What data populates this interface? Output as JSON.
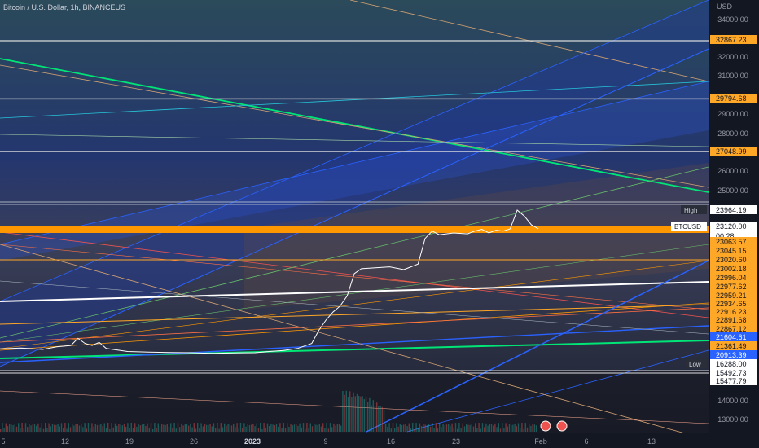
{
  "header": {
    "title": "Bitcoin / U.S. Dollar, 1h, BINANCEUS"
  },
  "chart_data": {
    "type": "line",
    "symbol": "BTCUSD",
    "currency_label": "USD",
    "price_ticks": [
      {
        "value": 34000,
        "label": "34000.00"
      },
      {
        "value": 32000,
        "label": "32000.00"
      },
      {
        "value": 31000,
        "label": "31000.00"
      },
      {
        "value": 29000,
        "label": "29000.00"
      },
      {
        "value": 28000,
        "label": "28000.00"
      },
      {
        "value": 26000,
        "label": "26000.00"
      },
      {
        "value": 25000,
        "label": "25000.00"
      },
      {
        "value": 14000,
        "label": "14000.00"
      },
      {
        "value": 13000,
        "label": "13000.00"
      }
    ],
    "x_ticks": [
      "5",
      "12",
      "19",
      "26",
      "2023",
      "9",
      "16",
      "23",
      "Feb",
      "6",
      "13"
    ],
    "price_labels": [
      {
        "text": "32867.23",
        "value": 32867.23,
        "bg": "#ffa726",
        "fg": "#131722"
      },
      {
        "text": "29794.68",
        "value": 29794.68,
        "bg": "#ffa726",
        "fg": "#131722"
      },
      {
        "text": "27048.99",
        "value": 27048.99,
        "bg": "#ffa726",
        "fg": "#131722"
      },
      {
        "text": "23964.19",
        "value": 23964.19,
        "bg": "#ffffff",
        "fg": "#131722",
        "tag": "High"
      },
      {
        "text": "23120.00",
        "value": 23120.0,
        "bg": "#ffffff",
        "fg": "#131722",
        "tag": "BTCUSD"
      },
      {
        "text": "00:28",
        "value": 23110,
        "bg": "#ffffff",
        "fg": "#131722"
      },
      {
        "text": "23063.57",
        "value": 23063.57,
        "bg": "#ffa726",
        "fg": "#131722"
      },
      {
        "text": "23045.15",
        "value": 23045.15,
        "bg": "#ffa726",
        "fg": "#131722"
      },
      {
        "text": "23020.60",
        "value": 23020.6,
        "bg": "#ffa726",
        "fg": "#131722"
      },
      {
        "text": "23002.18",
        "value": 23002.18,
        "bg": "#ffa726",
        "fg": "#131722"
      },
      {
        "text": "22996.04",
        "value": 22996.04,
        "bg": "#ffa726",
        "fg": "#131722"
      },
      {
        "text": "22977.62",
        "value": 22977.62,
        "bg": "#ffa726",
        "fg": "#131722"
      },
      {
        "text": "22959.21",
        "value": 22959.21,
        "bg": "#ffa726",
        "fg": "#131722"
      },
      {
        "text": "22934.65",
        "value": 22934.65,
        "bg": "#ffa726",
        "fg": "#131722"
      },
      {
        "text": "22916.23",
        "value": 22916.23,
        "bg": "#ffa726",
        "fg": "#131722"
      },
      {
        "text": "22891.68",
        "value": 22891.68,
        "bg": "#ffa726",
        "fg": "#131722"
      },
      {
        "text": "22867.12",
        "value": 22867.12,
        "bg": "#ffa726",
        "fg": "#131722"
      },
      {
        "text": "21604.61",
        "value": 21604.61,
        "bg": "#2962ff",
        "fg": "#ffffff"
      },
      {
        "text": "21361.49",
        "value": 21361.49,
        "bg": "#ffa726",
        "fg": "#131722"
      },
      {
        "text": "20913.39",
        "value": 20913.39,
        "bg": "#2962ff",
        "fg": "#ffffff"
      },
      {
        "text": "16288.00",
        "value": 16288.0,
        "bg": "#ffffff",
        "fg": "#131722",
        "tag": "Low"
      },
      {
        "text": "15492.73",
        "value": 15492.73,
        "bg": "#ffffff",
        "fg": "#131722"
      },
      {
        "text": "15477.79",
        "value": 15477.79,
        "bg": "#ffffff",
        "fg": "#131722"
      }
    ],
    "price_series": [
      [
        0,
        16980
      ],
      [
        0.03,
        17020
      ],
      [
        0.06,
        16950
      ],
      [
        0.08,
        17080
      ],
      [
        0.1,
        17150
      ],
      [
        0.11,
        17500
      ],
      [
        0.12,
        17250
      ],
      [
        0.13,
        17150
      ],
      [
        0.14,
        17300
      ],
      [
        0.15,
        17000
      ],
      [
        0.18,
        16850
      ],
      [
        0.21,
        16820
      ],
      [
        0.24,
        16800
      ],
      [
        0.27,
        16790
      ],
      [
        0.3,
        16760
      ],
      [
        0.33,
        16780
      ],
      [
        0.36,
        16790
      ],
      [
        0.38,
        16850
      ],
      [
        0.4,
        16900
      ],
      [
        0.42,
        17000
      ],
      [
        0.44,
        17250
      ],
      [
        0.45,
        17900
      ],
      [
        0.46,
        18400
      ],
      [
        0.47,
        18800
      ],
      [
        0.48,
        19100
      ],
      [
        0.49,
        19600
      ],
      [
        0.5,
        20700
      ],
      [
        0.51,
        20950
      ],
      [
        0.53,
        21000
      ],
      [
        0.55,
        21050
      ],
      [
        0.57,
        20900
      ],
      [
        0.58,
        21050
      ],
      [
        0.59,
        21200
      ],
      [
        0.6,
        22600
      ],
      [
        0.61,
        23000
      ],
      [
        0.62,
        22800
      ],
      [
        0.64,
        22900
      ],
      [
        0.66,
        22850
      ],
      [
        0.67,
        23000
      ],
      [
        0.68,
        23100
      ],
      [
        0.69,
        22900
      ],
      [
        0.7,
        23050
      ],
      [
        0.71,
        23000
      ],
      [
        0.72,
        23120
      ],
      [
        0.73,
        23964
      ],
      [
        0.74,
        23700
      ],
      [
        0.75,
        23300
      ],
      [
        0.76,
        23120
      ]
    ],
    "drawn_lines": "many overlapping trendlines, fib channels and horizontal levels in orange, blue, green, white",
    "colors": {
      "background": "#131722",
      "price_line": "#ffffff",
      "accent": "#ff9800",
      "blue": "#2962ff",
      "green": "#00e676"
    }
  }
}
